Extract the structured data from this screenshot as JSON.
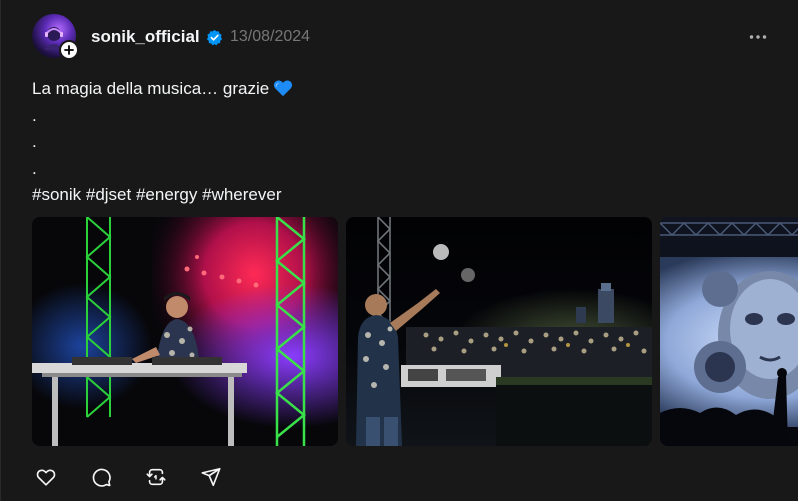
{
  "post": {
    "author": {
      "username": "sonik_official",
      "verified": true,
      "avatar": "dj-avatar",
      "follow_icon": "plus-icon"
    },
    "date": "13/08/2024",
    "more_icon": "more-horizontal-icon",
    "caption": {
      "lines": [
        "La magia della musica… grazie",
        ".",
        ".",
        ".",
        "#sonik #djset #energy #wherever"
      ],
      "emoji": "blue-heart-icon"
    },
    "media": [
      {
        "name": "dj-on-stage-photo"
      },
      {
        "name": "dj-facing-crowd-photo"
      },
      {
        "name": "stage-mask-screen-photo"
      }
    ],
    "actions": [
      {
        "name": "like",
        "icon": "heart-icon"
      },
      {
        "name": "comment",
        "icon": "comment-icon"
      },
      {
        "name": "repost",
        "icon": "repost-icon"
      },
      {
        "name": "share",
        "icon": "send-icon"
      }
    ],
    "colors": {
      "background": "#181818",
      "text": "#f3f5f7",
      "muted": "#777777",
      "verified": "#0095f6",
      "emoji": "#1d8cf8"
    }
  }
}
